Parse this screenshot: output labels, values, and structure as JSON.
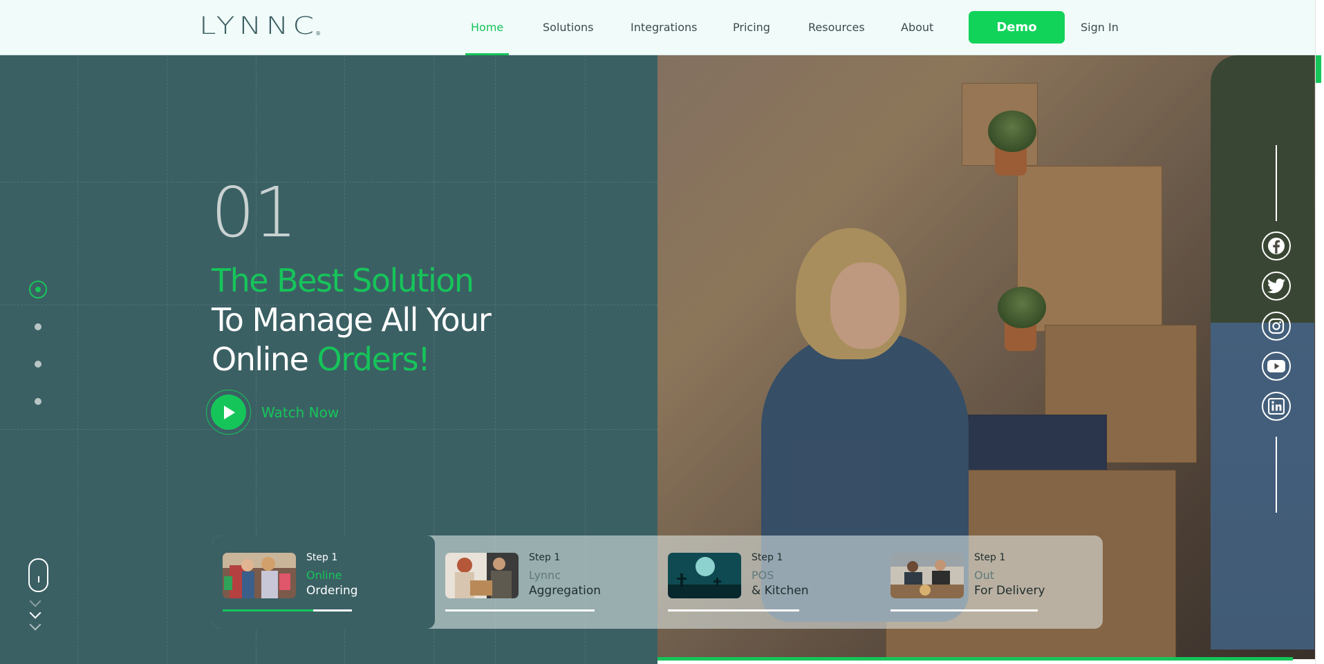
{
  "brand": {
    "logo_text": "LYNNC",
    "logo_mark": "®"
  },
  "nav": {
    "items": [
      {
        "label": "Home",
        "active": true
      },
      {
        "label": "Solutions",
        "active": false
      },
      {
        "label": "Integrations",
        "active": false
      },
      {
        "label": "Pricing",
        "active": false
      },
      {
        "label": "Resources",
        "active": false
      },
      {
        "label": "About",
        "active": false
      }
    ],
    "demo_label": "Demo",
    "signin_label": "Sign In"
  },
  "hero": {
    "slide_number": "01",
    "title_part1": "The Best Solution",
    "title_part2": "To Manage All Your",
    "title_part3": "Online ",
    "title_part4": "Orders!",
    "watch_label": "Watch Now",
    "slides_total": 4,
    "slide_active_index": 0
  },
  "social": [
    "facebook-icon",
    "twitter-icon",
    "instagram-icon",
    "youtube-icon",
    "linkedin-icon"
  ],
  "steps": [
    {
      "step": "Step 1",
      "line1": "Online",
      "line2": "Ordering",
      "progress": 0.7,
      "active": true,
      "thumb": "shopping-women-thumb"
    },
    {
      "step": "Step 1",
      "line1": "Lynnc",
      "line2": "Aggregation",
      "progress": 0,
      "active": false,
      "thumb": "delivery-thumb"
    },
    {
      "step": "Step 1",
      "line1": "POS",
      "line2": "& Kitchen",
      "progress": 0,
      "active": false,
      "thumb": "night-scene-thumb"
    },
    {
      "step": "Step 1",
      "line1": "Out",
      "line2": "For Delivery",
      "progress": 0,
      "active": false,
      "thumb": "kitchen-chefs-thumb"
    }
  ],
  "colors": {
    "accent": "#16c55a",
    "hero_bg": "#3b6064",
    "nav_bg": "#f1fbfa",
    "text_dark": "#3b4a4c"
  }
}
